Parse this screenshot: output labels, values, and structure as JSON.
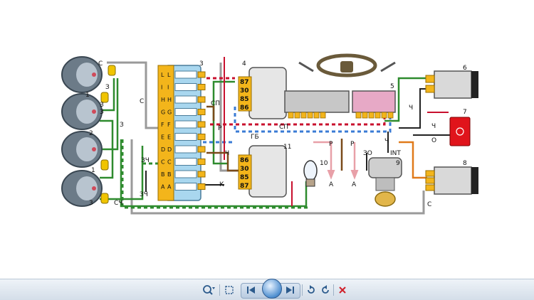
{
  "labels": {
    "headlight_1": "1",
    "headlight_2": "2",
    "headlight_3": "3",
    "fuse_box": "3",
    "relay_4": "4",
    "switch_5": "5",
    "switch_6": "6",
    "lamp_7": "7",
    "switch_8": "8",
    "ignition_9": "9",
    "bulb_10": "10",
    "relay_11": "11"
  },
  "fuse_letters_top": [
    "A",
    "A",
    "B",
    "B",
    "C",
    "C",
    "D",
    "D",
    "E",
    "E",
    "F",
    "F",
    "G",
    "G",
    "H",
    "H",
    "I",
    "I",
    "L",
    "L"
  ],
  "relay_4_pins": [
    "87",
    "30",
    "85",
    "86"
  ],
  "relay_11_pins": [
    "86",
    "30",
    "85",
    "87"
  ],
  "wire_tags": {
    "c_top": "С",
    "c_left": "С",
    "z_left": "З",
    "z_small_1": "З",
    "z_small_2": "З",
    "z_left2": "З",
    "zch_1": "ЗЧ",
    "zch_2": "ЗЧ",
    "sch": "СЧ",
    "sp_1": "СП",
    "sp_2": "СП",
    "r_1": "Р",
    "r_2": "Р",
    "r_3": "Р",
    "ch_1": "Ч",
    "ch_2": "Ч",
    "ch_3": "Ч",
    "ch_4": "Ч",
    "k": "К",
    "gb": "ГБ",
    "zo": "ЗО",
    "int": "INT",
    "o": "О",
    "c_right": "С",
    "a_1": "А",
    "a_2": "А"
  },
  "wire_colors": {
    "grey": "#9a9a9a",
    "green": "#2e8b2e",
    "red": "#c8102e",
    "blue": "#3a7bd5",
    "yellow": "#f0c400",
    "brown": "#7a4a1a",
    "black": "#222222",
    "orange": "#e07a1a",
    "pink": "#e8a0a8"
  },
  "component_colors": {
    "fuse_box": "#a9d7ef",
    "fuse_bar": "#f3b51b",
    "switch_5_pink": "#e7a9c6",
    "lamp_7": "#e0141b",
    "relay": "#e6e6e6"
  },
  "toolbar": {
    "zoom_icon": "magnifier-icon",
    "fit_icon": "fit-window-icon",
    "prev_icon": "previous-icon",
    "slideshow_icon": "slideshow-icon",
    "next_icon": "next-icon",
    "rotate_ccw_icon": "rotate-counterclockwise-icon",
    "rotate_cw_icon": "rotate-clockwise-icon",
    "delete_icon": "delete-icon"
  }
}
